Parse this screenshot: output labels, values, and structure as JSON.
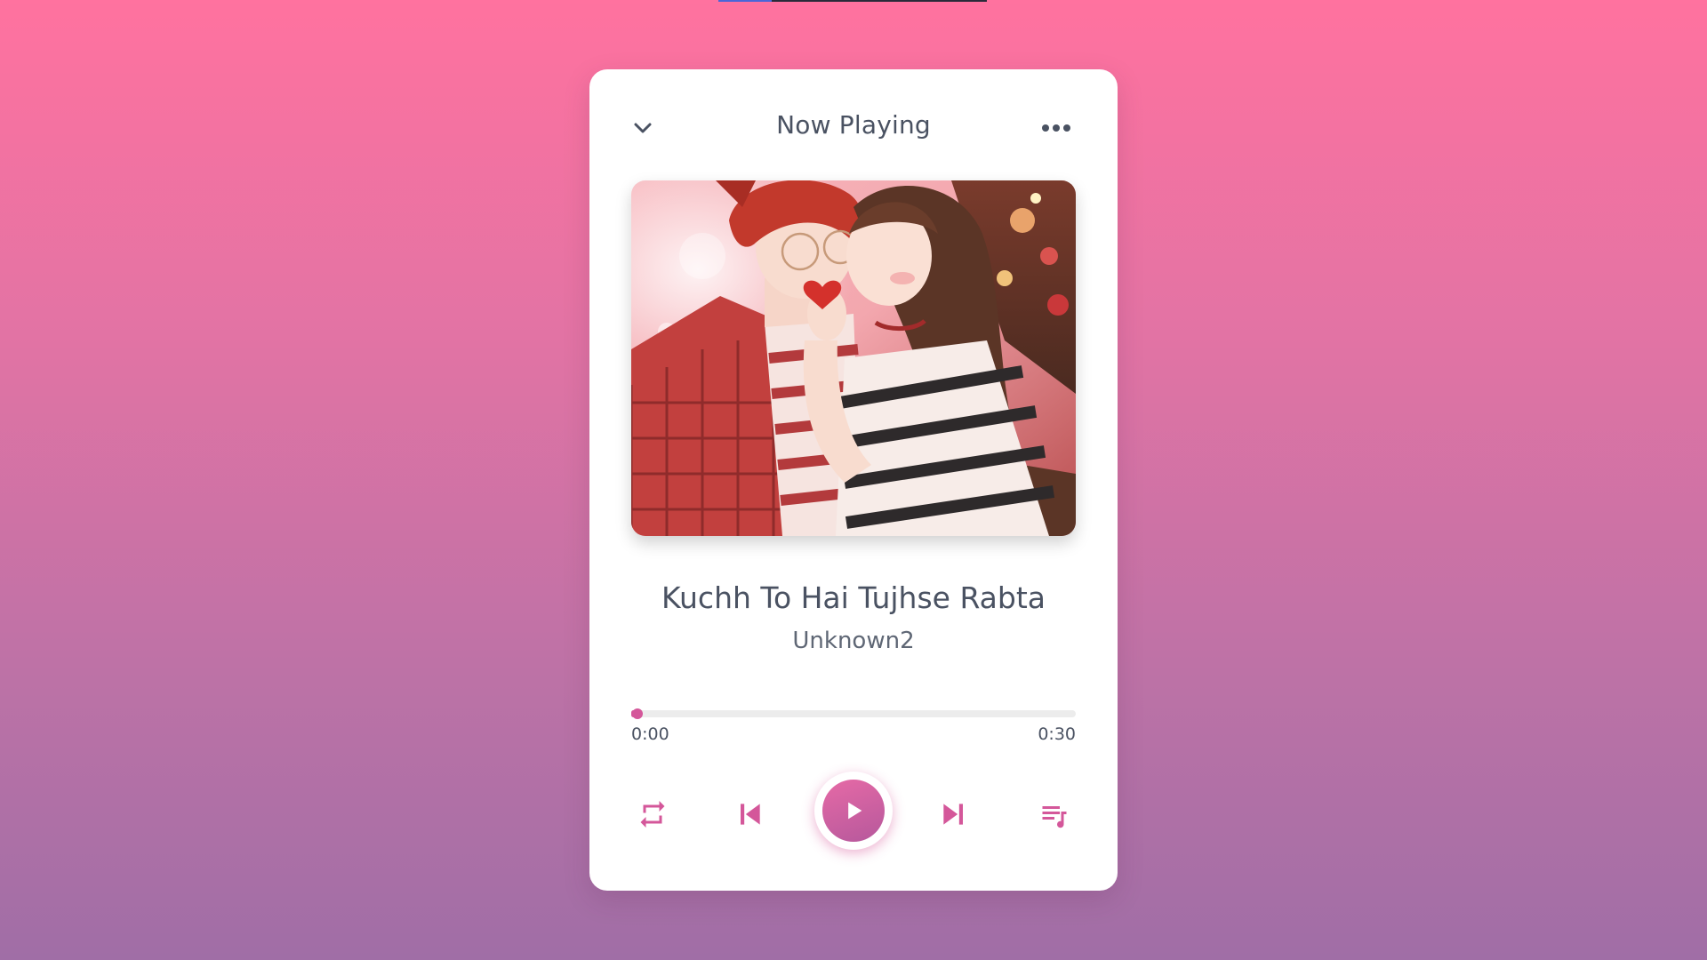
{
  "header": {
    "title": "Now Playing"
  },
  "track": {
    "title": "Kuchh To Hai Tujhse Rabta",
    "artist": "Unknown2",
    "current_time": "0:00",
    "duration": "0:30",
    "progress_fraction": 0.01
  },
  "icons": {
    "collapse": "chevron-down-icon",
    "more": "more-horizontal-icon",
    "repeat": "repeat-icon",
    "previous": "skip-previous-icon",
    "play": "play-icon",
    "next": "skip-next-icon",
    "playlist": "playlist-icon"
  },
  "colors": {
    "accent": "#d4579a",
    "text": "#4a5262",
    "background_top": "#ff729f",
    "background_bottom": "#a06ea6"
  }
}
